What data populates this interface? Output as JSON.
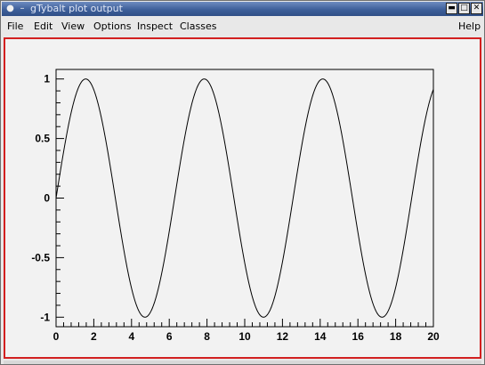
{
  "window": {
    "title": "gTybalt plot output",
    "sysmenu_icon": "window-menu-icon",
    "controls": {
      "minimize_icon": "minimize-icon",
      "maximize_icon": "maximize-icon",
      "close_icon": "close-icon"
    }
  },
  "menubar": {
    "file": "File",
    "edit": "Edit",
    "view": "View",
    "options": "Options",
    "inspect": "Inspect",
    "classes": "Classes",
    "help": "Help"
  },
  "colors": {
    "canvas_border": "#d22020",
    "canvas_bg": "#f2f2f2",
    "titlebar": "#3e5f9a"
  },
  "chart_data": {
    "type": "line",
    "function": "sin(x)",
    "xlim": [
      0,
      20
    ],
    "ylim": [
      -1.08,
      1.08
    ],
    "x_ticks": [
      0,
      2,
      4,
      6,
      8,
      10,
      12,
      14,
      16,
      18,
      20
    ],
    "x_tick_labels": [
      "0",
      "2",
      "4",
      "6",
      "8",
      "10",
      "12",
      "14",
      "16",
      "18",
      "20"
    ],
    "y_ticks": [
      -1,
      -0.5,
      0,
      0.5,
      1
    ],
    "y_tick_labels": [
      "-1",
      "-0.5",
      "0",
      "0.5",
      "1"
    ],
    "title": "",
    "xlabel": "",
    "ylabel": "",
    "grid": false,
    "series": [
      {
        "color": "#000000"
      }
    ]
  }
}
